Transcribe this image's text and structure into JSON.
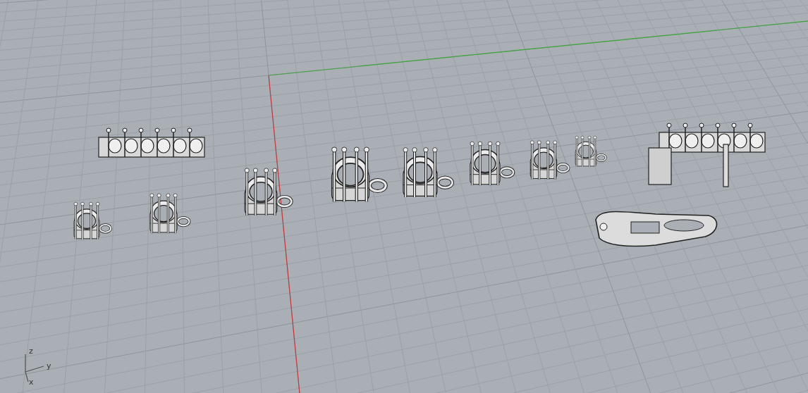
{
  "axis_widget": {
    "labels": [
      {
        "kind": "z",
        "text": "z"
      },
      {
        "kind": "y",
        "text": "y"
      },
      {
        "kind": "x",
        "text": "x"
      }
    ]
  }
}
